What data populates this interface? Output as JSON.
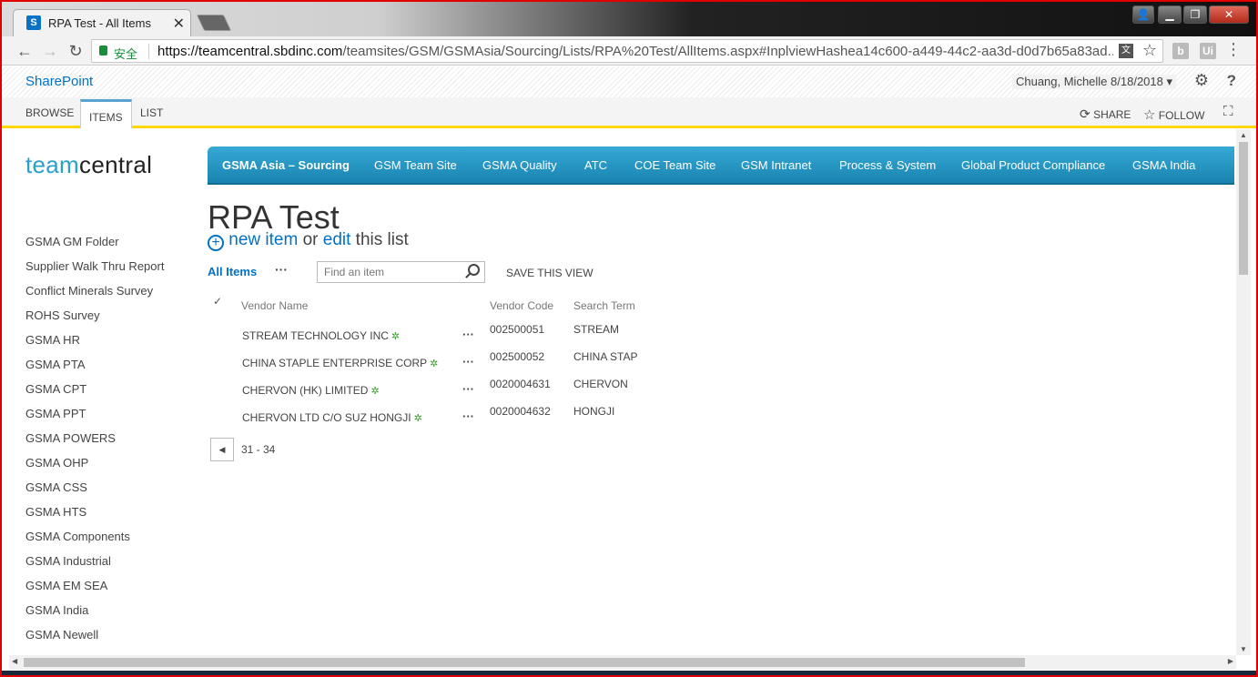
{
  "browser": {
    "tab_title": "RPA Test - All Items",
    "tab_close": "✕",
    "favicon_text": "S",
    "secure_label": "安全",
    "url_host": "https://teamcentral.sbdinc.com",
    "url_path": "/teamsites/GSM/GSMAsia/Sourcing/Lists/RPA%20Test/AllItems.aspx#InplviewHashea14c600-a449-44c2-aa3d-d0d7b65a83ad...",
    "ext1": "b",
    "ext2": "Ui",
    "translate_icon": "文"
  },
  "suite": {
    "brand": "SharePoint",
    "user": "Chuang, Michelle 8/18/2018 ▾"
  },
  "ribbon": {
    "tabs": [
      "BROWSE",
      "ITEMS",
      "LIST"
    ],
    "share": "SHARE",
    "follow": "FOLLOW"
  },
  "logo": {
    "part1": "team",
    "part2": "central"
  },
  "topnav": [
    "GSMA Asia – Sourcing",
    "GSM Team Site",
    "GSMA Quality",
    "ATC",
    "COE Team Site",
    "GSM Intranet",
    "Process & System",
    "Global Product Compliance",
    "GSMA India"
  ],
  "leftnav": [
    "GSMA GM Folder",
    "Supplier Walk Thru Report",
    "Conflict Minerals Survey",
    "ROHS Survey",
    "GSMA HR",
    "GSMA PTA",
    "GSMA CPT",
    "GSMA PPT",
    "GSMA POWERS",
    "GSMA OHP",
    "GSMA CSS",
    "GSMA HTS",
    "GSMA Components",
    "GSMA Industrial",
    "GSMA EM SEA",
    "GSMA India",
    "GSMA Newell"
  ],
  "page": {
    "title": "RPA Test",
    "new_item": "new item",
    "or": " or ",
    "edit": "edit",
    "this_list": " this list"
  },
  "view": {
    "all_items": "All Items",
    "search_placeholder": "Find an item",
    "save_view": "SAVE THIS VIEW"
  },
  "table": {
    "headers": {
      "check": "✓",
      "vendor_name": "Vendor Name",
      "vendor_code": "Vendor Code",
      "search_term": "Search Term"
    },
    "rows": [
      {
        "vendor_name": "STREAM TECHNOLOGY INC",
        "vendor_code": "002500051",
        "search_term": "STREAM"
      },
      {
        "vendor_name": "CHINA STAPLE ENTERPRISE CORP",
        "vendor_code": "002500052",
        "search_term": "CHINA STAP"
      },
      {
        "vendor_name": "CHERVON (HK) LIMITED",
        "vendor_code": "0020004631",
        "search_term": "CHERVON"
      },
      {
        "vendor_name": "CHERVON LTD C/O SUZ HONGJI",
        "vendor_code": "0020004632",
        "search_term": "HONGJI"
      }
    ]
  },
  "pager": {
    "range": "31 - 34"
  },
  "colors": {
    "accent": "#0072c6",
    "nav": "#1a84b0",
    "ribbon_border": "#ffd800",
    "new_marker": "#3a9e2c"
  }
}
